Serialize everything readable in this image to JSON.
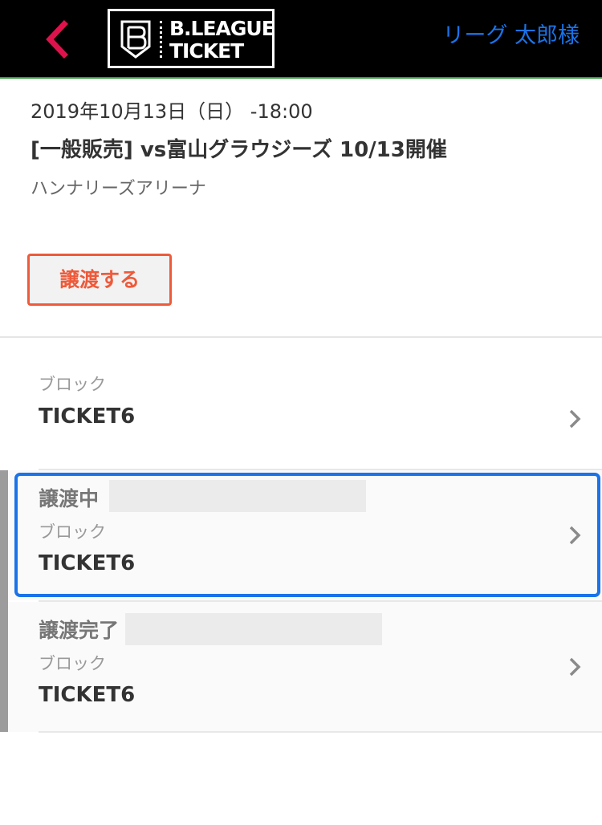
{
  "header": {
    "logo_line1": "B.LEAGUE",
    "logo_line2": "TICKET",
    "user_name": "リーグ 太郎様",
    "back_icon": "chevron-left-icon",
    "colors": {
      "background": "#000000",
      "back_arrow": "#e0124c",
      "user_name": "#1a73e8",
      "bottom_border": "#2f9e3a"
    }
  },
  "event": {
    "datetime": "2019年10月13日（日） -18:00",
    "title": "[一般販売] vs富山グラウジーズ 10/13開催",
    "venue": "ハンナリーズアリーナ",
    "transfer_button_label": "譲渡する",
    "transfer_button_color": "#ee5a3a"
  },
  "tickets": [
    {
      "status": "",
      "block_label": "ブロック",
      "name": "TICKET6",
      "chevron_icon": "chevron-right-icon"
    },
    {
      "status": "譲渡中",
      "block_label": "ブロック",
      "name": "TICKET6",
      "chevron_icon": "chevron-right-icon",
      "selected": true
    },
    {
      "status": "譲渡完了",
      "block_label": "ブロック",
      "name": "TICKET6",
      "chevron_icon": "chevron-right-icon"
    }
  ],
  "colors": {
    "selection_outline": "#1a73e8"
  }
}
